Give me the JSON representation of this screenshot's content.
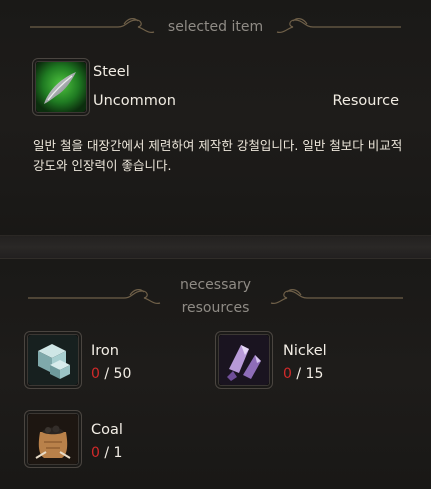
{
  "selected": {
    "header": "selected item",
    "name": "Steel",
    "rarity": "Uncommon",
    "category": "Resource",
    "description": "일반 철을 대장간에서 제련하여 제작한 강철입니다. 일반 철보다 비교적 강도와 인장력이 좋습니다.",
    "icon": "steel-ingot-icon"
  },
  "requirements": {
    "header_line1": "necessary",
    "header_line2": "resources",
    "items": [
      {
        "name": "Iron",
        "have": "0",
        "separator": " / ",
        "need": "50",
        "icon": "iron-cube-icon"
      },
      {
        "name": "Nickel",
        "have": "0",
        "separator": " / ",
        "need": "15",
        "icon": "nickel-crystal-icon"
      },
      {
        "name": "Coal",
        "have": "0",
        "separator": " / ",
        "need": "1",
        "icon": "coal-sack-icon"
      }
    ]
  },
  "colors": {
    "insufficient": "#d12a2a",
    "ornament": "#6e5f48",
    "rarity_green": "#3fa23a"
  }
}
